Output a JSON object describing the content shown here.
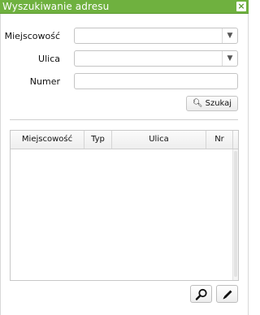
{
  "window": {
    "title": "Wyszukiwanie adresu",
    "close_icon": "close-icon"
  },
  "form": {
    "miejscowosc_label": "Miejscowość",
    "miejscowosc_value": "",
    "ulica_label": "Ulica",
    "ulica_value": "",
    "numer_label": "Numer",
    "numer_value": "",
    "search_button": "Szukaj"
  },
  "grid": {
    "columns": [
      "Miejscowość",
      "Typ",
      "Ulica",
      "Nr"
    ],
    "rows": []
  },
  "toolbar": {
    "details_icon": "magnifier-icon",
    "edit_icon": "pencil-icon"
  },
  "colors": {
    "titlebar": "#6fb13f"
  }
}
